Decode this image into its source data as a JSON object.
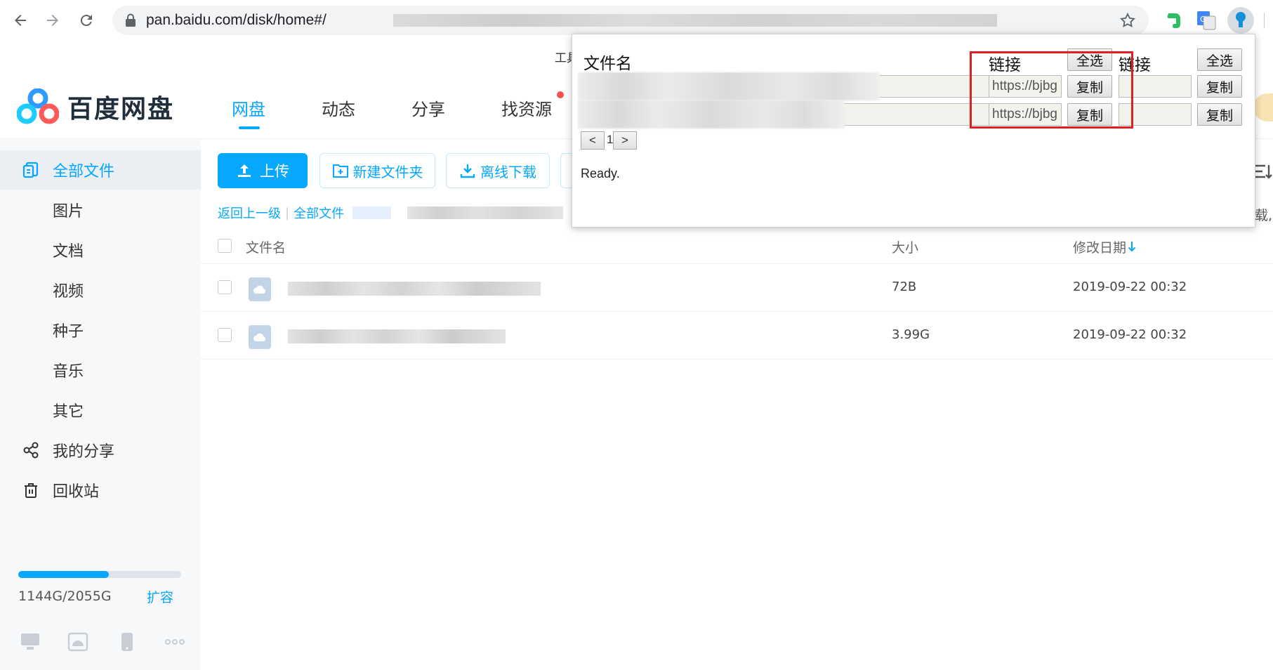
{
  "browser": {
    "url": "pan.baidu.com/disk/home#/",
    "bookmark_fragment": "工具"
  },
  "header": {
    "logo_text": "百度网盘",
    "nav": [
      {
        "label": "网盘",
        "active": true
      },
      {
        "label": "动态",
        "active": false
      },
      {
        "label": "分享",
        "active": false
      },
      {
        "label": "找资源",
        "active": false
      }
    ]
  },
  "sidebar": {
    "items": [
      {
        "label": "全部文件",
        "icon": "files-icon",
        "active": true
      },
      {
        "label": "图片"
      },
      {
        "label": "文档"
      },
      {
        "label": "视频"
      },
      {
        "label": "种子"
      },
      {
        "label": "音乐"
      },
      {
        "label": "其它"
      },
      {
        "label": "我的分享",
        "icon": "share-icon"
      },
      {
        "label": "回收站",
        "icon": "trash-icon"
      }
    ],
    "quota": {
      "used_fraction": 0.555,
      "text": "1144G/2055G",
      "expand_label": "扩容"
    }
  },
  "toolbar": {
    "upload_label": "上传",
    "new_folder_label": "新建文件夹",
    "offline_download_label": "离线下载"
  },
  "breadcrumb": {
    "back_label": "返回上一级",
    "separator": "|",
    "all_files_label": "全部文件"
  },
  "file_list": {
    "columns": {
      "name": "文件名",
      "size": "大小",
      "modified": "修改日期"
    },
    "rows": [
      {
        "size": "72B",
        "modified": "2019-09-22 00:32"
      },
      {
        "size": "3.99G",
        "modified": "2019-09-22 00:32"
      }
    ]
  },
  "popup": {
    "header_filename": "文件名",
    "header_link_1": "链接",
    "header_link_2": "链接",
    "select_all_label": "全选",
    "copy_label": "复制",
    "rows": [
      {
        "link_1": "https://bjbg",
        "link_2": ""
      },
      {
        "link_1": "https://bjbg",
        "link_2": ""
      }
    ],
    "pager": {
      "prev": "<",
      "page": "1",
      "next": ">"
    },
    "status": "Ready."
  },
  "right_edge_fragment": "载,",
  "colors": {
    "accent": "#06a7ff",
    "highlight": "#e02020",
    "sidebar_bg": "#f7f8fa"
  }
}
